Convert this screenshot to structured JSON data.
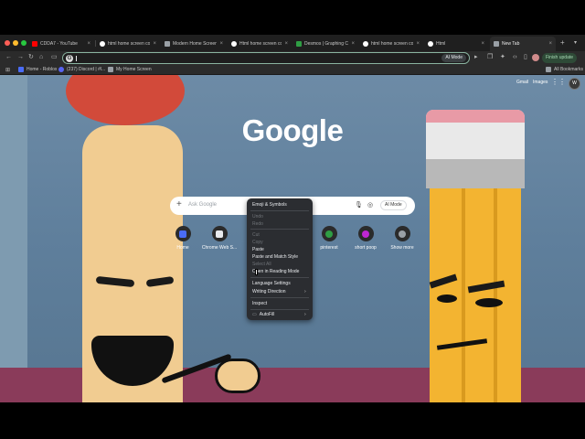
{
  "tabs": [
    {
      "title": "CDDA7 - YouTube",
      "favicon_color": "#ff0000"
    },
    {
      "title": "html home screen co",
      "favicon_color": "#ffffff"
    },
    {
      "title": "Modern Home Screen",
      "favicon_color": "#9aa0a6"
    },
    {
      "title": "Html home screen co",
      "favicon_color": "#ffffff"
    },
    {
      "title": "Desmos | Graphing C",
      "favicon_color": "#2f9e44"
    },
    {
      "title": "html home screen co",
      "favicon_color": "#ffffff"
    },
    {
      "title": "Html",
      "favicon_color": "#ffffff"
    },
    {
      "title": "New Tab",
      "favicon_color": "#9aa0a6"
    }
  ],
  "toolbar": {
    "ai_mode_label": "AI Mode",
    "finish_update_label": "Finish update"
  },
  "bookmarks": {
    "items": [
      {
        "label": "Home - Roblox",
        "favicon_color": "#4a6cf7"
      },
      {
        "label": "(237) Discord | #l...",
        "favicon_color": "#5865f2"
      },
      {
        "label": "My Home Screen",
        "favicon_color": "#9aa0a6"
      }
    ],
    "all_label": "All Bookmarks"
  },
  "header": {
    "gmail": "Gmail",
    "images": "Images",
    "avatar_initials": "W"
  },
  "logo": "Google",
  "search": {
    "placeholder": "Ask Google",
    "ai_mode_label": "AI Mode"
  },
  "shortcuts": [
    {
      "label": "Home",
      "color": "#4a6cf7"
    },
    {
      "label": "Chrome Web S...",
      "color": "#e8eaed"
    },
    {
      "label": "pinterest",
      "color": "#2f9e44"
    },
    {
      "label": "short poop",
      "color": "#c026d3"
    },
    {
      "label": "Show more",
      "color": "#9aa0a6"
    }
  ],
  "context_menu": {
    "items": [
      {
        "label": "Emoji & Symbols",
        "enabled": true
      },
      {
        "label": "Undo",
        "enabled": false
      },
      {
        "label": "Redo",
        "enabled": false
      },
      {
        "label": "Cut",
        "enabled": false
      },
      {
        "label": "Copy",
        "enabled": false
      },
      {
        "label": "Paste",
        "enabled": true
      },
      {
        "label": "Paste and Match Style",
        "enabled": true
      },
      {
        "label": "Select All",
        "enabled": false
      },
      {
        "label": "Open in Reading Mode",
        "enabled": true
      },
      {
        "label": "Language Settings",
        "enabled": true
      },
      {
        "label": "Writing Direction",
        "enabled": true
      },
      {
        "label": "Inspect",
        "enabled": true
      },
      {
        "label": "AutoFill",
        "enabled": true
      }
    ]
  }
}
